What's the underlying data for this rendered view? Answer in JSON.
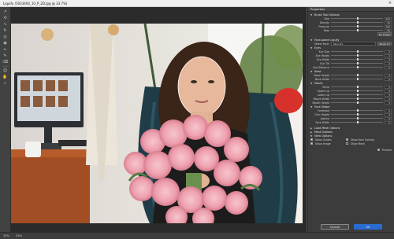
{
  "window": {
    "title": "Liquify (5033404_10_P_2D.Jpg @ 33.7%)",
    "close_glyph": "×"
  },
  "tools": [
    {
      "name": "forward-warp-tool",
      "glyph": "↗"
    },
    {
      "name": "reconstruct-tool",
      "glyph": "⟲"
    },
    {
      "name": "smooth-tool",
      "glyph": "∿"
    },
    {
      "name": "twirl-tool",
      "glyph": "↻"
    },
    {
      "name": "pucker-tool",
      "glyph": "◎"
    },
    {
      "name": "bloat-tool",
      "glyph": "◉"
    },
    {
      "name": "push-left-tool",
      "glyph": "⇐"
    },
    {
      "name": "freeze-mask-tool",
      "glyph": "✎"
    },
    {
      "name": "thaw-mask-tool",
      "glyph": "⌫"
    },
    {
      "name": "face-tool",
      "glyph": "☺"
    },
    {
      "name": "hand-tool",
      "glyph": "✋"
    },
    {
      "name": "zoom-tool",
      "glyph": "⌕"
    }
  ],
  "status": {
    "zoom": "33%",
    "zoom2": "33%"
  },
  "panel": {
    "title": "Properties",
    "brush_section": "Brush Tool Options",
    "brush_rows": [
      {
        "label": "Size",
        "value": "100"
      },
      {
        "label": "Density",
        "value": "50"
      },
      {
        "label": "Pressure",
        "value": "100"
      },
      {
        "label": "Rate",
        "value": "80"
      }
    ],
    "stylus_btn": "Pin Edges",
    "face_section": "Face-Aware Liquify",
    "select_face_label": "Select Face:",
    "select_face_value": "Face #1",
    "reset_all": "Reset All",
    "eyes_section": "Eyes",
    "eye_rows": [
      {
        "label": "Eye Size",
        "value": "0"
      },
      {
        "label": "Eye Height",
        "value": "0"
      },
      {
        "label": "Eye Width",
        "value": "0"
      },
      {
        "label": "Eye Tilt",
        "value": "0"
      },
      {
        "label": "Eye Distance",
        "value": "0"
      }
    ],
    "nose_section": "Nose",
    "nose_rows": [
      {
        "label": "Nose Height",
        "value": "0"
      },
      {
        "label": "Nose Width",
        "value": "0"
      }
    ],
    "mouth_section": "Mouth",
    "mouth_rows": [
      {
        "label": "Smile",
        "value": "0"
      },
      {
        "label": "Upper Lip",
        "value": "0"
      },
      {
        "label": "Lower Lip",
        "value": "0"
      },
      {
        "label": "Mouth Width",
        "value": "0"
      },
      {
        "label": "Mouth Height",
        "value": "0"
      }
    ],
    "shape_section": "Face Shape",
    "shape_rows": [
      {
        "label": "Forehead",
        "value": "0"
      },
      {
        "label": "Chin Height",
        "value": "0"
      },
      {
        "label": "Jawline",
        "value": "0"
      },
      {
        "label": "Face Width",
        "value": "0"
      }
    ],
    "load_mesh": "Load Mesh Options",
    "mask_options": "Mask Options",
    "view_options": "View Options",
    "show_guides": "Show Guides",
    "show_face_overlay": "Show Face Overlay",
    "show_image": "Show Image",
    "show_mesh": "Show Mesh",
    "preview_label": "Preview",
    "cancel": "Cancel",
    "ok": "OK"
  }
}
